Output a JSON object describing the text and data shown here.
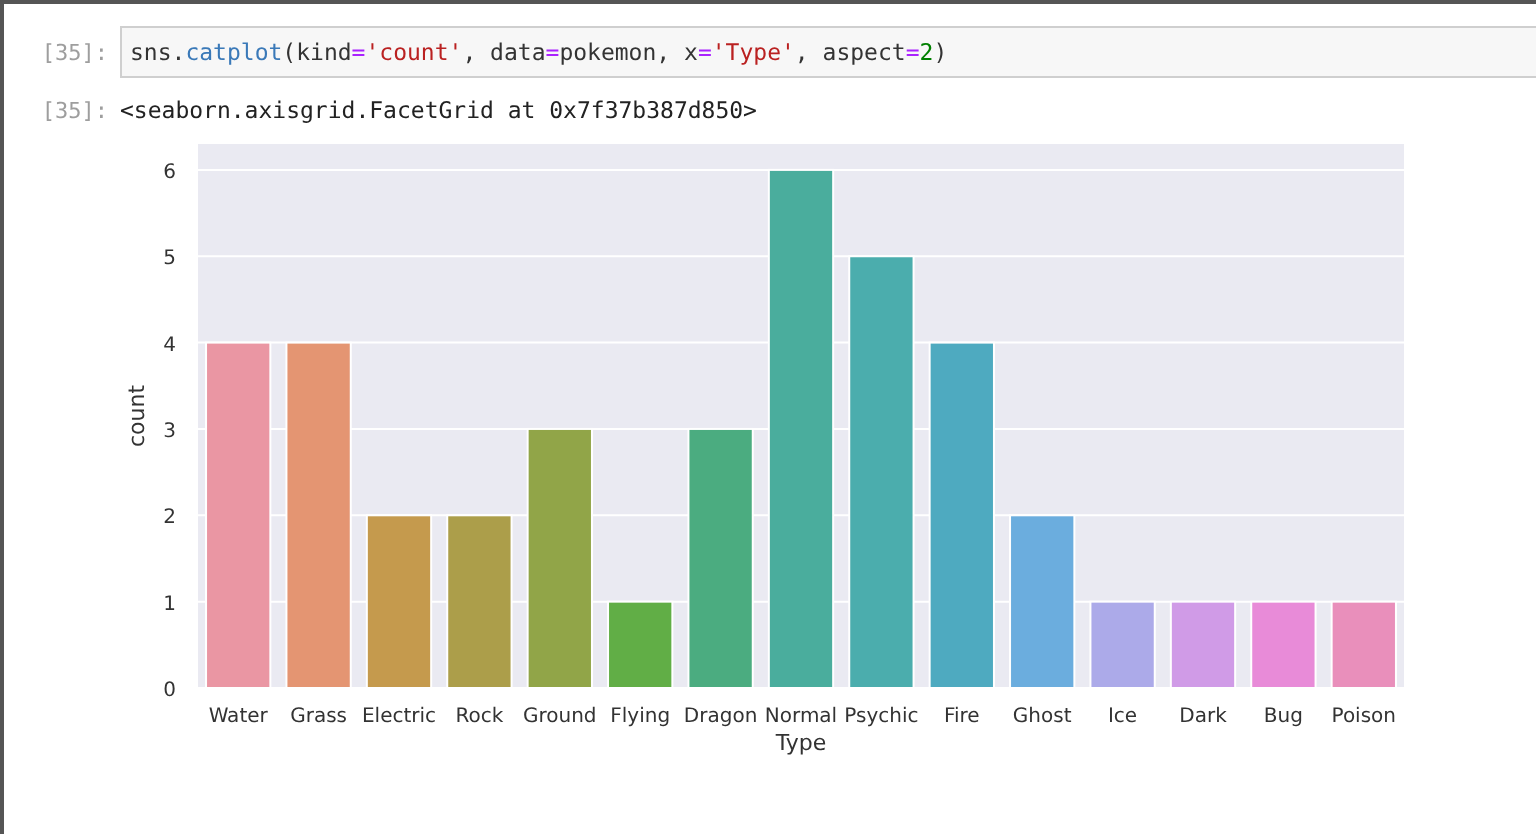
{
  "input_cell": {
    "prompt": "[35]:",
    "code": [
      {
        "kind": "name",
        "text": "sns."
      },
      {
        "kind": "func",
        "text": "catplot"
      },
      {
        "kind": "name",
        "text": "(kind"
      },
      {
        "kind": "op",
        "text": "="
      },
      {
        "kind": "string",
        "text": "'count'"
      },
      {
        "kind": "name",
        "text": ", data"
      },
      {
        "kind": "op",
        "text": "="
      },
      {
        "kind": "name",
        "text": "pokemon, x"
      },
      {
        "kind": "op",
        "text": "="
      },
      {
        "kind": "string",
        "text": "'Type'"
      },
      {
        "kind": "name",
        "text": ", aspect"
      },
      {
        "kind": "op",
        "text": "="
      },
      {
        "kind": "number",
        "text": "2"
      },
      {
        "kind": "name",
        "text": ")"
      }
    ]
  },
  "output_cell": {
    "prompt": "[35]:",
    "text": "<seaborn.axisgrid.FacetGrid at 0x7f37b387d850>",
    "chart_data": {
      "type": "bar",
      "xlabel": "Type",
      "ylabel": "count",
      "categories": [
        "Water",
        "Grass",
        "Electric",
        "Rock",
        "Ground",
        "Flying",
        "Dragon",
        "Normal",
        "Psychic",
        "Fire",
        "Ghost",
        "Ice",
        "Dark",
        "Bug",
        "Poison"
      ],
      "series": [
        {
          "values": [
            4,
            4,
            2,
            2,
            3,
            1,
            3,
            6,
            5,
            4,
            2,
            1,
            1,
            1,
            1
          ]
        }
      ],
      "grid": true,
      "colors": [
        "#ea96a3",
        "#e49572",
        "#c59a4d",
        "#ac9e4a",
        "#91a548",
        "#61ae46",
        "#4bac80",
        "#4aad9d",
        "#4badad",
        "#4eaac0",
        "#6badde",
        "#acaae9",
        "#d09be7",
        "#e88bd8",
        "#e98fbb"
      ],
      "ylim": [
        0,
        6.3
      ],
      "yticks": [
        0,
        1,
        2,
        3,
        4,
        5,
        6
      ]
    }
  }
}
